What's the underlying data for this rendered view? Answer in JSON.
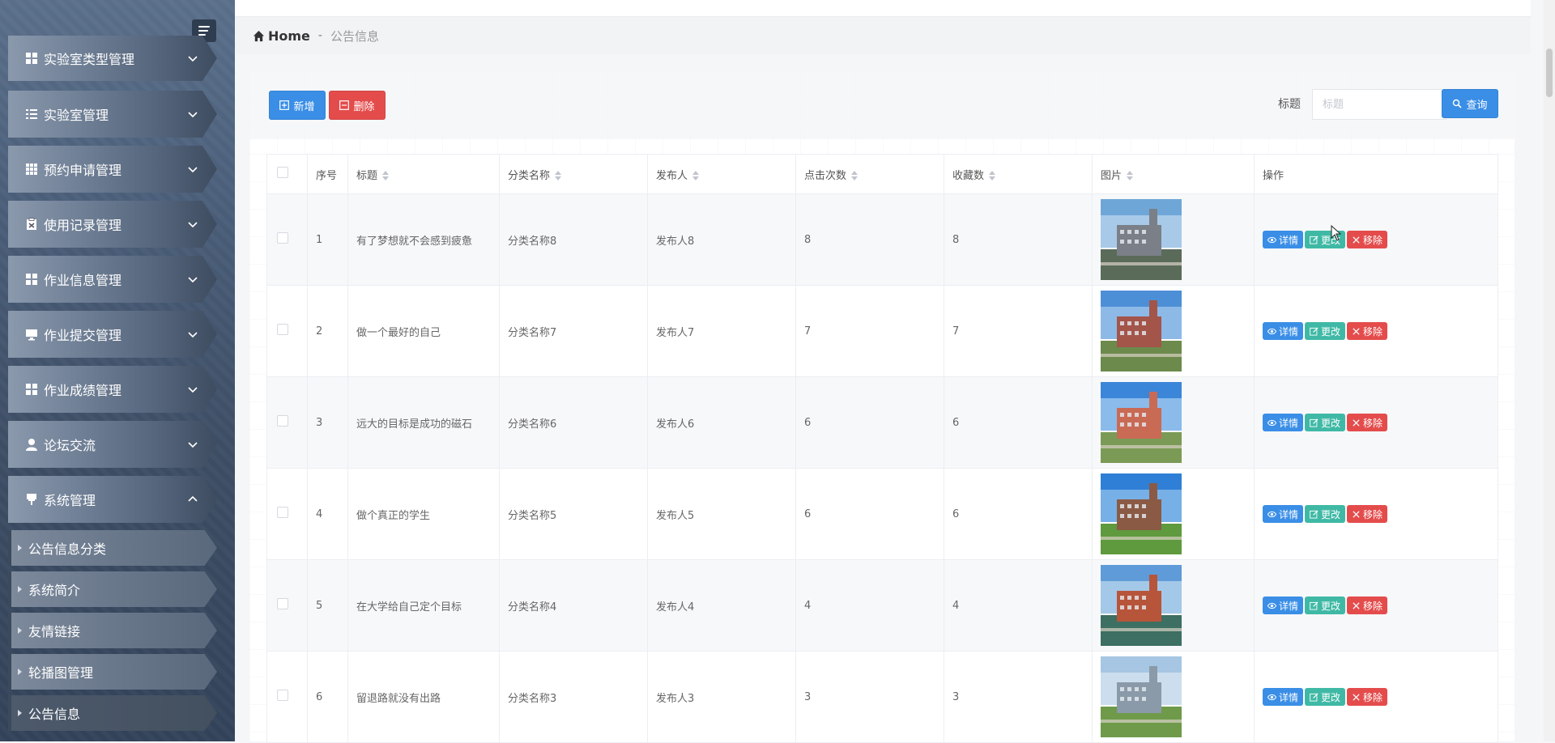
{
  "sidebar": {
    "menu": [
      {
        "label": "实验室类型管理",
        "icon": "grid-icon"
      },
      {
        "label": "实验室管理",
        "icon": "list-icon"
      },
      {
        "label": "预约申请管理",
        "icon": "grid-icon"
      },
      {
        "label": "使用记录管理",
        "icon": "clipboard-icon"
      },
      {
        "label": "作业信息管理",
        "icon": "grid-icon"
      },
      {
        "label": "作业提交管理",
        "icon": "monitor-icon"
      },
      {
        "label": "作业成绩管理",
        "icon": "grid-icon"
      },
      {
        "label": "论坛交流",
        "icon": "user-icon"
      },
      {
        "label": "系统管理",
        "icon": "pin-icon"
      }
    ],
    "submenu": [
      {
        "label": "公告信息分类"
      },
      {
        "label": "系统简介"
      },
      {
        "label": "友情链接"
      },
      {
        "label": "轮播图管理"
      },
      {
        "label": "公告信息"
      }
    ]
  },
  "breadcrumb": {
    "home": "Home",
    "separator": "-",
    "current": "公告信息"
  },
  "toolbar": {
    "add_label": "新增",
    "delete_label": "删除",
    "search_label": "标题",
    "search_placeholder": "标题",
    "search_button": "查询"
  },
  "table": {
    "columns": [
      "序号",
      "标题",
      "分类名称",
      "发布人",
      "点击次数",
      "收藏数",
      "图片",
      "操作"
    ],
    "actions": {
      "detail": "详情",
      "edit": "更改",
      "remove": "移除"
    },
    "rows": [
      {
        "index": "1",
        "title": "有了梦想就不会感到疲惫",
        "category": "分类名称8",
        "publisher": "发布人8",
        "clicks": "8",
        "favorites": "8"
      },
      {
        "index": "2",
        "title": "做一个最好的自己",
        "category": "分类名称7",
        "publisher": "发布人7",
        "clicks": "7",
        "favorites": "7"
      },
      {
        "index": "3",
        "title": "远大的目标是成功的磁石",
        "category": "分类名称6",
        "publisher": "发布人6",
        "clicks": "6",
        "favorites": "6"
      },
      {
        "index": "4",
        "title": "做个真正的学生",
        "category": "分类名称5",
        "publisher": "发布人5",
        "clicks": "6",
        "favorites": "6"
      },
      {
        "index": "5",
        "title": "在大学给自己定个目标",
        "category": "分类名称4",
        "publisher": "发布人4",
        "clicks": "4",
        "favorites": "4"
      },
      {
        "index": "6",
        "title": "留退路就没有出路",
        "category": "分类名称3",
        "publisher": "发布人3",
        "clicks": "3",
        "favorites": "3"
      }
    ]
  },
  "colors": {
    "primary": "#3a8ee6",
    "danger": "#e44c4c",
    "success": "#3fb9a5"
  }
}
